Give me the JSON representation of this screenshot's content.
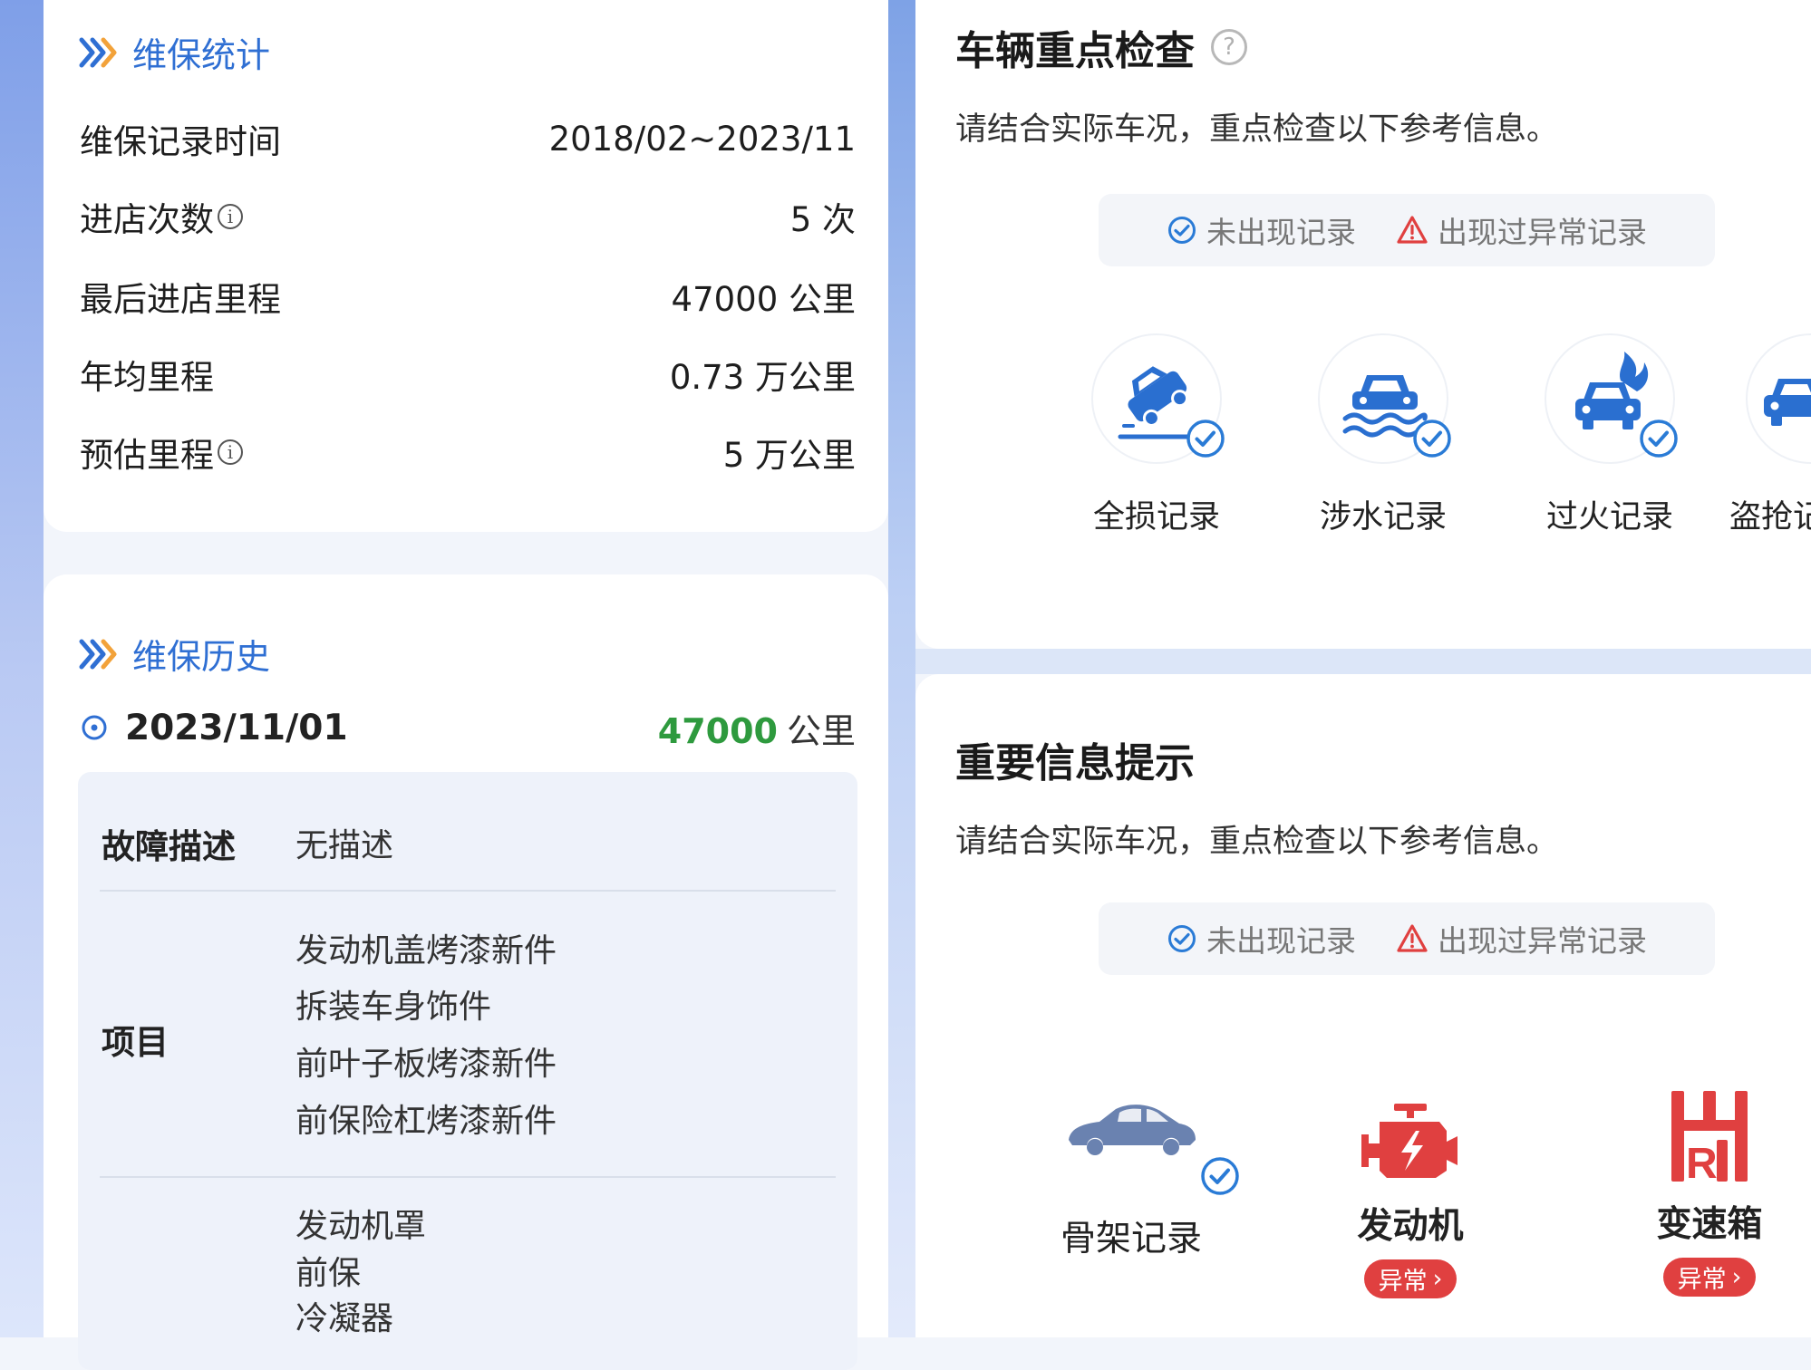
{
  "maintenance_stats": {
    "title": "维保统计",
    "rows": [
      {
        "label": "维保记录时间",
        "value": "2018/02~2023/11",
        "info": false
      },
      {
        "label": "进店次数",
        "value": "5 次",
        "info": true
      },
      {
        "label": "最后进店里程",
        "value": "47000 公里",
        "info": false
      },
      {
        "label": "年均里程",
        "value": "0.73 万公里",
        "info": false
      },
      {
        "label": "预估里程",
        "value": "5 万公里",
        "info": true
      }
    ]
  },
  "maintenance_history": {
    "title": "维保历史",
    "record": {
      "date": "2023/11/01",
      "mileage_value": "47000",
      "mileage_unit": "公里",
      "fault_label": "故障描述",
      "fault_value": "无描述",
      "items_label": "项目",
      "items": [
        "发动机盖烤漆新件",
        "拆装车身饰件",
        "前叶子板烤漆新件",
        "前保险杠烤漆新件"
      ],
      "parts": [
        "发动机罩",
        "前保",
        "冷凝器"
      ]
    }
  },
  "key_inspection": {
    "title": "车辆重点检查",
    "subtitle": "请结合实际车况，重点检查以下参考信息。",
    "legend_ok": "未出现记录",
    "legend_warn": "出现过异常记录",
    "items": [
      {
        "label": "全损记录",
        "icon": "total-loss-car-icon",
        "status": "ok"
      },
      {
        "label": "涉水记录",
        "icon": "flood-car-icon",
        "status": "ok"
      },
      {
        "label": "过火记录",
        "icon": "fire-car-icon",
        "status": "ok"
      },
      {
        "label": "盗抢记录",
        "icon": "theft-car-icon",
        "status": "ok"
      }
    ]
  },
  "important_info": {
    "title": "重要信息提示",
    "subtitle": "请结合实际车况，重点检查以下参考信息。",
    "legend_ok": "未出现记录",
    "legend_warn": "出现过异常记录",
    "items": [
      {
        "label": "骨架记录",
        "icon": "car-frame-icon",
        "status": "ok"
      },
      {
        "label": "发动机",
        "icon": "engine-icon",
        "status": "异常"
      },
      {
        "label": "变速箱",
        "icon": "gearbox-icon",
        "status": "异常"
      }
    ]
  },
  "colors": {
    "accent_blue": "#2f6fd3",
    "ok_blue": "#2a7bd6",
    "warn_red": "#e04040",
    "mileage_green": "#2e9a3e"
  }
}
